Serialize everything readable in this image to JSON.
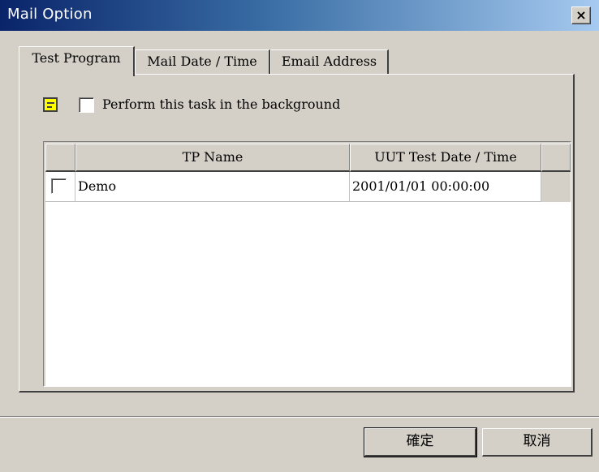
{
  "window": {
    "title": "Mail Option",
    "close_glyph": "×",
    "icons": [
      "close-icon",
      "note-icon"
    ]
  },
  "tabs": [
    {
      "label": "Test Program",
      "active": true
    },
    {
      "label": "Mail Date / Time",
      "active": false
    },
    {
      "label": "Email Address",
      "active": false
    }
  ],
  "background_task": {
    "label": "Perform this task in the background",
    "checked": false
  },
  "table": {
    "columns": [
      "TP Name",
      "UUT Test Date / Time"
    ],
    "rows": [
      {
        "checked": false,
        "tp_name": "Demo",
        "date_time": "2001/01/01 00:00:00"
      }
    ]
  },
  "buttons": {
    "ok": "確定",
    "cancel": "取消"
  }
}
